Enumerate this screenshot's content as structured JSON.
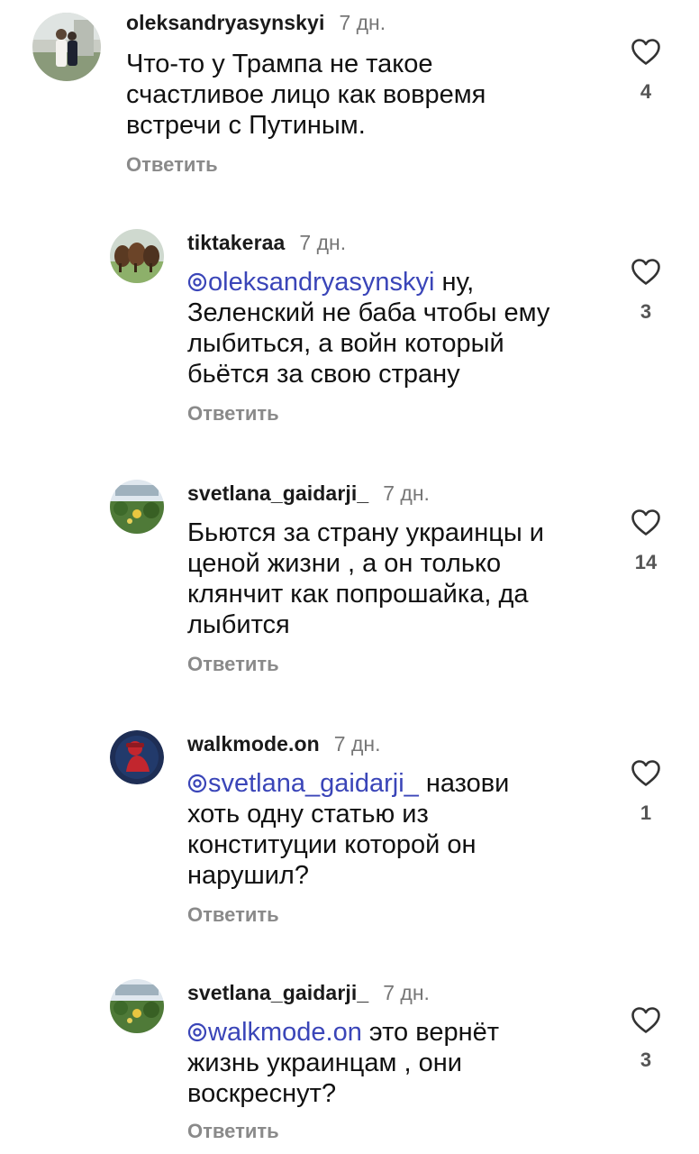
{
  "reply_label": "Ответить",
  "accent_colors": {
    "mention": "#3a45b8",
    "muted": "#8a8a8a"
  },
  "icons": {
    "like": "heart-outline-icon",
    "mention": "threads-at-icon"
  },
  "comments": [
    {
      "username": "oleksandryasynskyi",
      "time": "7 дн.",
      "lines": [
        "Что-то у Трампа не такое",
        "счастливое лицо как вовремя",
        "встречи с Путиным."
      ],
      "likes": "4"
    },
    {
      "username": "tiktakeraa",
      "time": "7 дн.",
      "mention": "oleksandryasynskyi",
      "lines": [
        " ну,",
        "Зеленский не баба чтобы ему",
        "лыбиться, а войн который",
        "бьётся за свою страну"
      ],
      "likes": "3"
    },
    {
      "username": "svetlana_gaidarji_",
      "time": "7 дн.",
      "lines": [
        "Бьются за страну украинцы и",
        "ценой жизни , а он только",
        "клянчит как попрошайка,  да",
        "лыбится"
      ],
      "likes": "14"
    },
    {
      "username": "walkmode.on",
      "time": "7 дн.",
      "mention": "svetlana_gaidarji_",
      "lines": [
        " назови",
        "хоть одну статью из",
        "конституции которой он",
        "нарушил?"
      ],
      "likes": "1"
    },
    {
      "username": "svetlana_gaidarji_",
      "time": "7 дн.",
      "mention": "walkmode.on",
      "lines": [
        " это вернёт",
        "жизнь украинцам , они",
        "воскреснут?"
      ],
      "likes": "3"
    }
  ]
}
